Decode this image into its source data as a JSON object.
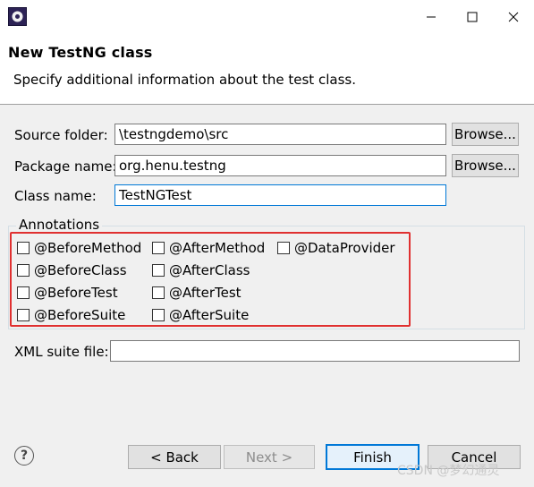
{
  "window": {
    "title": "New TestNG class",
    "subtitle": "Specify additional information about the test class."
  },
  "form": {
    "source_folder_label": "Source folder:",
    "source_folder_value": "\\testngdemo\\src",
    "package_name_label": "Package name:",
    "package_name_value": "org.henu.testng",
    "class_name_label": "Class name:",
    "class_name_value": "TestNGTest",
    "browse_label": "Browse...",
    "xml_suite_label": "XML suite file:",
    "xml_suite_value": ""
  },
  "annotations": {
    "group_label": "Annotations",
    "items": [
      {
        "label": "@BeforeMethod",
        "checked": false
      },
      {
        "label": "@AfterMethod",
        "checked": false
      },
      {
        "label": "@DataProvider",
        "checked": false
      },
      {
        "label": "@BeforeClass",
        "checked": false
      },
      {
        "label": "@AfterClass",
        "checked": false
      },
      {
        "label": "@BeforeTest",
        "checked": false
      },
      {
        "label": "@AfterTest",
        "checked": false
      },
      {
        "label": "@BeforeSuite",
        "checked": false
      },
      {
        "label": "@AfterSuite",
        "checked": false
      }
    ]
  },
  "footer": {
    "help": "?",
    "back_label": "< Back",
    "next_label": "Next >",
    "finish_label": "Finish",
    "cancel_label": "Cancel"
  },
  "watermark": "CSDN @梦幻通灵",
  "colors": {
    "highlight": "#e03030",
    "default_button_border": "#0078d7"
  }
}
